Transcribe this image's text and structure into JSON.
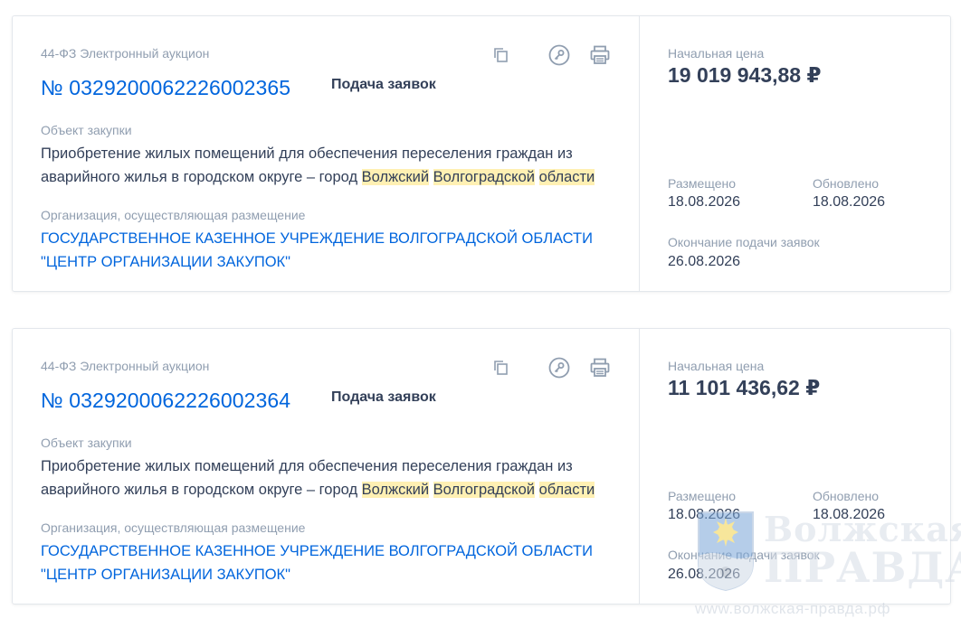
{
  "cards": [
    {
      "law": "44-ФЗ Электронный аукцион",
      "number": "№ 0329200062226002365",
      "stage": "Подача заявок",
      "object_label": "Объект закупки",
      "object_text_1": "Приобретение жилых помещений для обеспечения переселения граждан из аварийного жилья в городском округе – город ",
      "object_hl_1": "Волжский",
      "object_hl_2": "Волгоградской",
      "object_hl_3": "области",
      "org_label": "Организация, осуществляющая размещение",
      "org_name": "ГОСУДАРСТВЕННОЕ КАЗЕННОЕ УЧРЕЖДЕНИЕ ВОЛГОГРАДСКОЙ ОБЛАСТИ \"ЦЕНТР ОРГАНИЗАЦИИ ЗАКУПОК\"",
      "price_label": "Начальная цена",
      "price": "19 019 943,88 ₽",
      "placed_label": "Размещено",
      "placed": "18.08.2026",
      "updated_label": "Обновлено",
      "updated": "18.08.2026",
      "end_label": "Окончание подачи заявок",
      "end": "26.08.2026"
    },
    {
      "law": "44-ФЗ Электронный аукцион",
      "number": "№ 0329200062226002364",
      "stage": "Подача заявок",
      "object_label": "Объект закупки",
      "object_text_1": "Приобретение жилых помещений для обеспечения переселения граждан из аварийного жилья в городском округе – город ",
      "object_hl_1": "Волжский",
      "object_hl_2": "Волгоградской",
      "object_hl_3": "области",
      "org_label": "Организация, осуществляющая размещение",
      "org_name": "ГОСУДАРСТВЕННОЕ КАЗЕННОЕ УЧРЕЖДЕНИЕ ВОЛГОГРАДСКОЙ ОБЛАСТИ \"ЦЕНТР ОРГАНИЗАЦИИ ЗАКУПОК\"",
      "price_label": "Начальная цена",
      "price": "11 101 436,62 ₽",
      "placed_label": "Размещено",
      "placed": "18.08.2026",
      "updated_label": "Обновлено",
      "updated": "18.08.2026",
      "end_label": "Окончание подачи заявок",
      "end": "26.08.2026"
    }
  ],
  "icons": [
    "copy-icon",
    "key-icon",
    "print-icon"
  ],
  "watermark": {
    "title_1": "Волжская",
    "title_2": "ПРАВДА",
    "url": "www.волжская-правда.рф"
  },
  "colors": {
    "link": "#0065dd",
    "text": "#334059",
    "muted": "#909eb0",
    "highlight": "#fff0b3",
    "border": "#e3e7ec"
  }
}
